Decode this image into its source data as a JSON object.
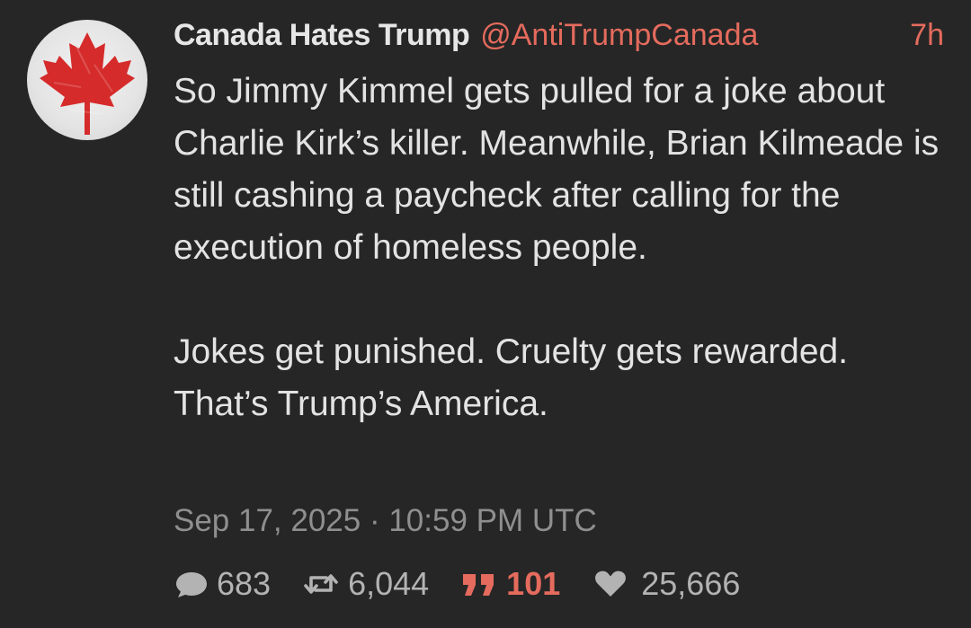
{
  "author": {
    "display_name": "Canada Hates Trump",
    "handle": "@AntiTrumpCanada",
    "avatar_icon": "maple-leaf-icon"
  },
  "post": {
    "time_ago": "7h",
    "paragraphs": [
      "So Jimmy Kimmel gets pulled for a joke about Charlie Kirk’s killer. Meanwhile, Brian Kilmeade is still cashing a paycheck after calling for the execution of homeless people.",
      "Jokes get punished. Cruelty gets rewarded. That’s Trump’s America."
    ],
    "timestamp": "Sep 17, 2025 · 10:59 PM UTC"
  },
  "stats": {
    "replies": "683",
    "reposts": "6,044",
    "quotes": "101",
    "likes": "25,666"
  },
  "colors": {
    "background": "#262626",
    "accent": "#e46b5d",
    "text": "#e3e3e3",
    "muted": "#8f8f8f",
    "icon": "#b3b3b3",
    "flag_red": "#d62b2b"
  }
}
